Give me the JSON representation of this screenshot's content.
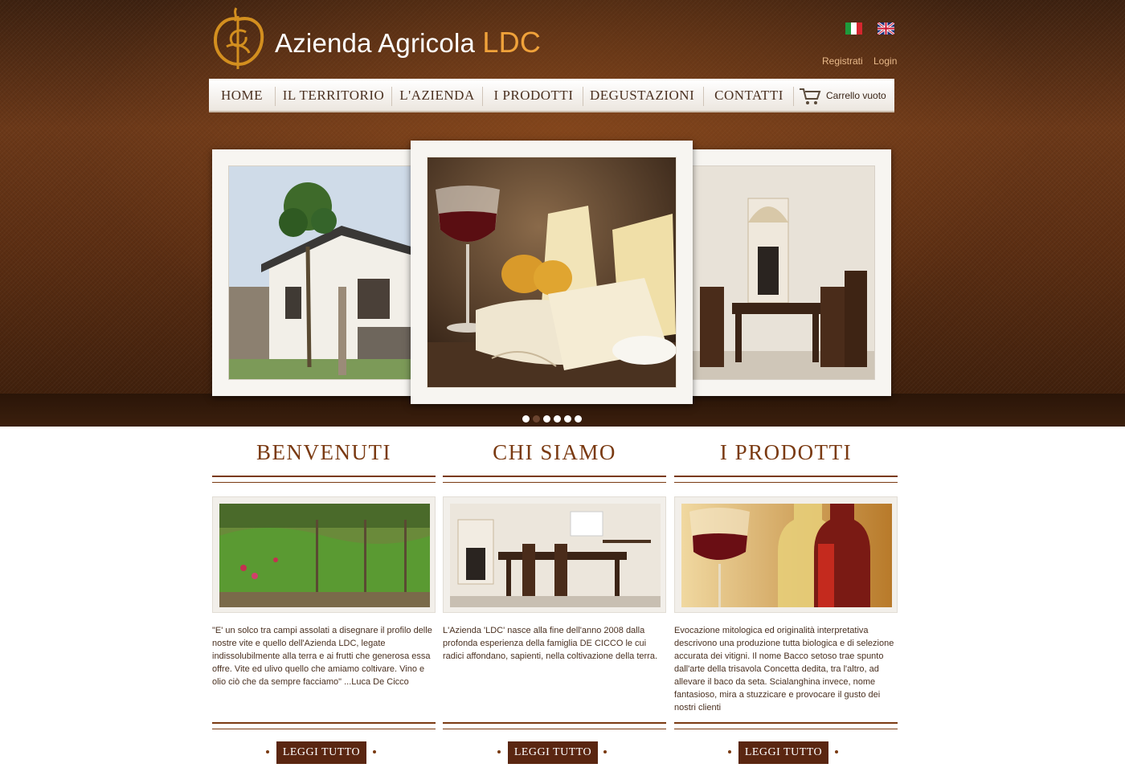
{
  "brand": {
    "name": "Azienda Agricola",
    "suffix": "LDC"
  },
  "header": {
    "register": "Registrati",
    "login": "Login",
    "lang_it": "Italiano",
    "lang_en": "English"
  },
  "nav": {
    "items": [
      "HOME",
      "IL TERRITORIO",
      "L'AZIENDA",
      "I PRODOTTI",
      "DEGUSTAZIONI",
      "CONTATTI"
    ],
    "cart_label": "Carrello vuoto"
  },
  "slider": {
    "slides_count": 6,
    "active_index": 1
  },
  "columns": [
    {
      "title": "BENVENUTI",
      "text": "\"E' un solco tra campi assolati a disegnare il profilo delle nostre vite e quello dell'Azienda LDC, legate indissolubilmente alla terra e ai frutti che generosa essa offre. Vite ed ulivo quello che amiamo coltivare. Vino e olio ciò che da sempre facciamo\" ...Luca De Cicco",
      "button": "LEGGI TUTTO"
    },
    {
      "title": "CHI SIAMO",
      "text": "L'Azienda 'LDC' nasce alla fine dell'anno 2008 dalla profonda esperienza della famiglia DE CICCO le cui radici affondano, sapienti, nella coltivazione della terra.",
      "button": "LEGGI TUTTO"
    },
    {
      "title": "I PRODOTTI",
      "text": "Evocazione mitologica ed originalità interpretativa descrivono una produzione tutta biologica e di selezione accurata dei vitigni. Il nome Bacco setoso trae spunto dall'arte della trisavola Concetta dedita, tra l'altro, ad allevare il baco da seta. Scialanghina invece, nome fantasioso, mira a stuzzicare e provocare il gusto dei nostri clienti",
      "button": "LEGGI TUTTO"
    }
  ],
  "colors": {
    "brown_dark": "#3d2110",
    "accent_gold": "#f0a23a",
    "title_brown": "#7a3a12",
    "button_bg": "#5a2611"
  }
}
